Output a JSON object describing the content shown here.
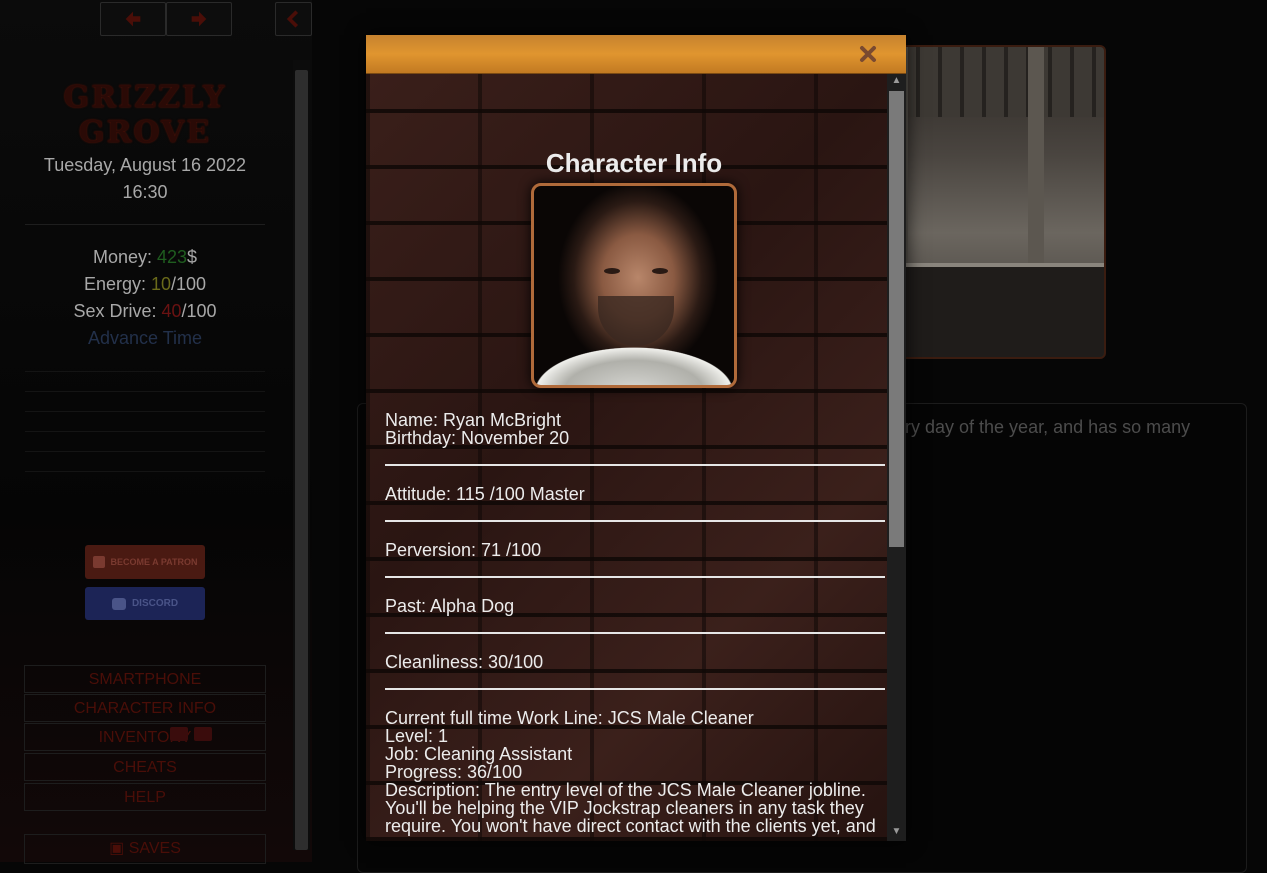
{
  "sidebar": {
    "game_title": "GRIZZLY GROVE",
    "date": "Tuesday, August 16 2022",
    "time": "16:30",
    "stats": {
      "money_label": "Money: ",
      "money_value": "423",
      "money_unit": "$",
      "energy_label": "Energy: ",
      "energy_value": "10",
      "energy_max": "/100",
      "sex_label": "Sex Drive: ",
      "sex_value": "40",
      "sex_max": "/100"
    },
    "advance_time": "Advance Time",
    "patron_button": "BECOME A PATRON",
    "discord_button": "DISCORD",
    "menu": {
      "smartphone": "SMARTPHONE",
      "character_info": "CHARACTER INFO",
      "inventory": "INVENTORY",
      "cheats": "CHEATS",
      "help": "HELP",
      "saves": "SAVES"
    }
  },
  "story": {
    "text_fragment": "ry day of the year, and has so many"
  },
  "modal": {
    "title": "Character Info",
    "name": "Name: Ryan McBright",
    "birthday": "Birthday: November 20",
    "attitude": "Attitude: 115 /100 Master",
    "perversion": "Perversion: 71 /100",
    "past": "Past: Alpha Dog",
    "cleanliness": "Cleanliness: 30/100",
    "work": {
      "line": "Current full time Work Line: JCS Male Cleaner",
      "level": "Level: 1",
      "job": "Job: Cleaning Assistant",
      "progress": "Progress: 36/100",
      "description_1": "Description: The entry level of the JCS Male Cleaner jobline.",
      "description_2": "You'll be helping the VIP Jockstrap cleaners in any task they",
      "description_3": "require. You won't have direct contact with the clients yet, and"
    }
  },
  "colors": {
    "modal_header": "#e0952f",
    "money_green": "#1f5d1f",
    "energy_yellow": "#6a6a1a",
    "sex_red": "#6a1212",
    "menu_text": "#4a0e08"
  }
}
